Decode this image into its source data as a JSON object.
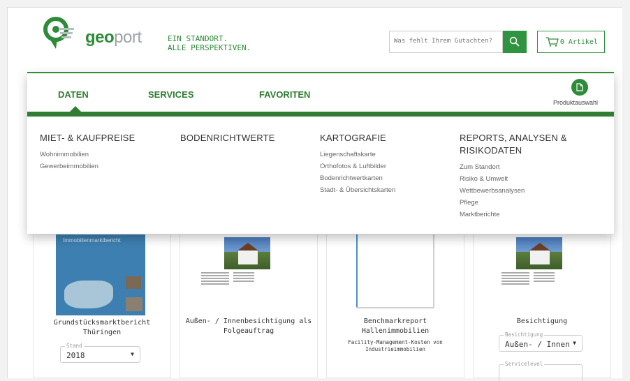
{
  "header": {
    "logo_text_bold": "geo",
    "logo_text_light": "port",
    "tagline_line1": "EIN STANDORT.",
    "tagline_line2": "ALLE PERSPEKTIVEN.",
    "search_placeholder": "Was fehlt Ihrem Gutachten?",
    "cart_label": "0 Artikel"
  },
  "nav": {
    "tabs": [
      {
        "label": "DATEN"
      },
      {
        "label": "SERVICES"
      },
      {
        "label": "FAVORITEN"
      }
    ],
    "product_label": "Produktauswahl"
  },
  "mega_menu": [
    {
      "title": "MIET- & KAUFPREISE",
      "items": [
        "Wohnimmobilien",
        "Gewerbeimmobilien"
      ]
    },
    {
      "title": "BODENRICHTWERTE",
      "items": []
    },
    {
      "title": "KARTOGRAFIE",
      "items": [
        "Liegenschaftskarte",
        "Orthofotos & Luftbilder",
        "Bodenrichtwertkarten",
        "Stadt- & Übersichtskarten"
      ]
    },
    {
      "title_line1": "REPORTS, ANALYSEN &",
      "title_line2": "RISIKODATEN",
      "items": [
        "Zum Standort",
        "Risiko & Umwelt",
        "Wettbewerbsanalysen",
        "Pflege",
        "Marktberichte"
      ]
    }
  ],
  "cards": [
    {
      "title_line1": "Grundstücksmarktbericht",
      "title_line2": "Thüringen",
      "cover_title": "Immobilienmarktbericht",
      "select_label": "Stand",
      "select_value": "2018"
    },
    {
      "title_line1": "Außen- / Innenbesichtigung als",
      "title_line2": "Folgeauftrag"
    },
    {
      "title_line1": "Benchmarkreport",
      "title_line2": "Hallenimmobilien",
      "subtitle_line1": "Facility-Management-Kosten von",
      "subtitle_line2": "Industrieimmobilien"
    },
    {
      "title_line1": "Besichtigung",
      "select_label": "Besichtigung",
      "select_value": "Außen- / Innen",
      "select2_label": "Servicelevel"
    }
  ],
  "colors": {
    "brand_green": "#2e8b3a",
    "nav_green": "#2e7d32",
    "button_green": "#2e9440"
  }
}
